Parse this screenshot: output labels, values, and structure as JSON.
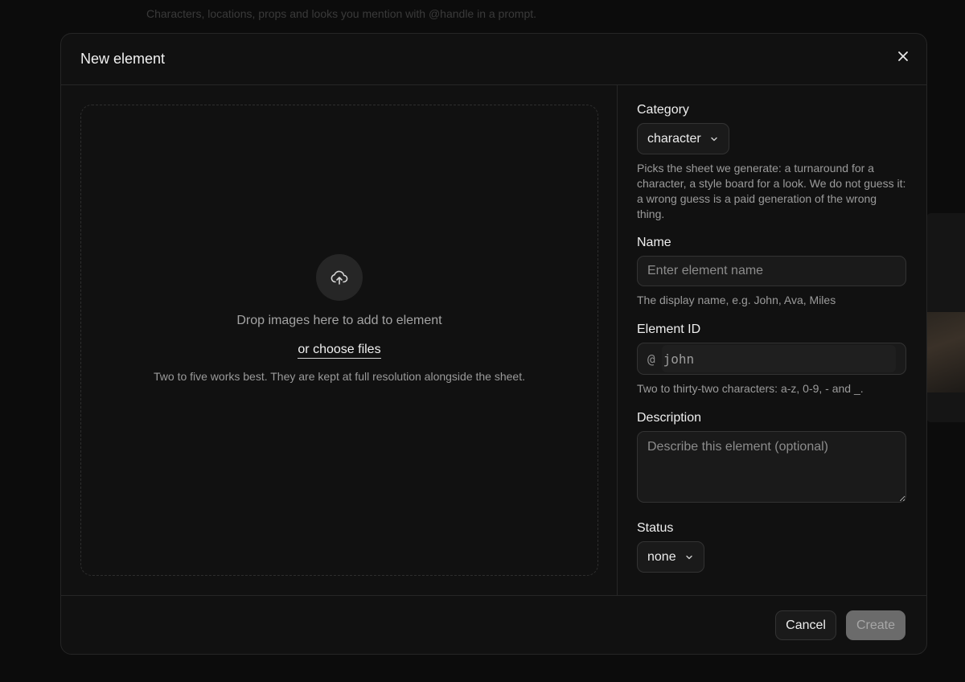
{
  "background": {
    "text": "Characters, locations, props and looks you mention with @handle in a prompt."
  },
  "modal": {
    "title": "New element"
  },
  "upload": {
    "drop_text": "Drop images here to add to element",
    "choose_label": "or choose files",
    "hint": "Two to five works best. They are kept at full resolution alongside the sheet."
  },
  "category": {
    "label": "Category",
    "value": "character",
    "help": "Picks the sheet we generate: a turnaround for a character, a style board for a look. We do not guess it: a wrong guess is a paid generation of the wrong thing."
  },
  "name": {
    "label": "Name",
    "placeholder": "Enter element name",
    "value": "",
    "help": "The display name, e.g. John, Ava, Miles"
  },
  "element_id": {
    "label": "Element ID",
    "prefix": "@",
    "placeholder": "john",
    "value": "",
    "help": "Two to thirty-two characters: a-z, 0-9, - and _."
  },
  "description": {
    "label": "Description",
    "placeholder": "Describe this element (optional)",
    "value": ""
  },
  "status": {
    "label": "Status",
    "value": "none"
  },
  "footer": {
    "cancel_label": "Cancel",
    "create_label": "Create"
  }
}
